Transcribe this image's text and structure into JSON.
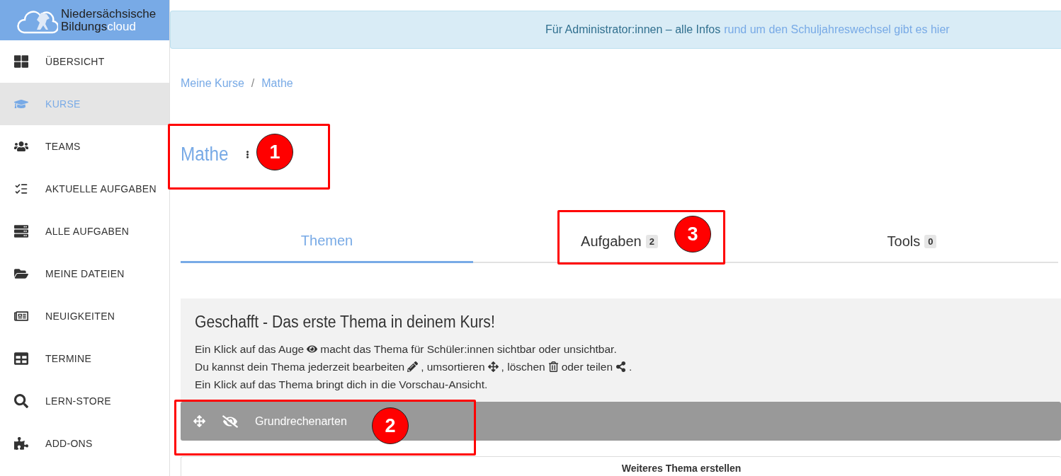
{
  "logo": {
    "line1": "Niedersächsische",
    "line2_main": "Bildungs",
    "line2_accent": "cloud"
  },
  "sidebar": {
    "items": [
      {
        "label": "ÜBERSICHT",
        "selected": false
      },
      {
        "label": "KURSE",
        "selected": true
      },
      {
        "label": "TEAMS",
        "selected": false
      },
      {
        "label": "AKTUELLE AUFGABEN",
        "selected": false
      },
      {
        "label": "ALLE AUFGABEN",
        "selected": false
      },
      {
        "label": "MEINE DATEIEN",
        "selected": false
      },
      {
        "label": "NEUIGKEITEN",
        "selected": false
      },
      {
        "label": "TERMINE",
        "selected": false
      },
      {
        "label": "LERN-STORE",
        "selected": false
      },
      {
        "label": "ADD-ONS",
        "selected": false
      }
    ]
  },
  "banner": {
    "text": "Für Administrator:innen – alle Infos",
    "link": "rund um den Schuljahreswechsel gibt es hier"
  },
  "breadcrumb": [
    {
      "label": "Meine Kurse"
    },
    {
      "label": "Mathe"
    }
  ],
  "breadcrumb_separator": "/",
  "course": {
    "title": "Mathe"
  },
  "tabs": [
    {
      "label": "Themen",
      "selected": true
    },
    {
      "label": "Aufgaben",
      "count": "2",
      "selected": false
    },
    {
      "label": "Tools",
      "count": "0",
      "selected": false
    }
  ],
  "info": {
    "heading": "Geschafft - Das erste Thema in deinem Kurs!",
    "lines": [
      [
        {
          "kind": "text",
          "text": "Ein Klick auf das Auge"
        },
        {
          "kind": "eye"
        },
        {
          "kind": "text",
          "text": "macht das Thema für Schüler:innen sichtbar oder unsichtbar."
        }
      ],
      [
        {
          "kind": "text",
          "text": "Du kannst dein Thema jederzeit bearbeiten"
        },
        {
          "kind": "pencil"
        },
        {
          "kind": "text",
          "text": ", umsortieren"
        },
        {
          "kind": "move"
        },
        {
          "kind": "text",
          "text": ", löschen"
        },
        {
          "kind": "trash"
        },
        {
          "kind": "text",
          "text": "oder teilen"
        },
        {
          "kind": "share"
        },
        {
          "kind": "text",
          "text": "."
        }
      ],
      [
        {
          "kind": "text",
          "text": "Ein Klick auf das Thema bringt dich in die Vorschau-Ansicht."
        }
      ]
    ]
  },
  "topics": [
    {
      "title": "Grundrechenarten",
      "visible": false
    }
  ],
  "new_topic": {
    "label": "Weiteres Thema erstellen"
  },
  "callouts": [
    {
      "number": "1"
    },
    {
      "number": "2"
    },
    {
      "number": "3"
    }
  ]
}
